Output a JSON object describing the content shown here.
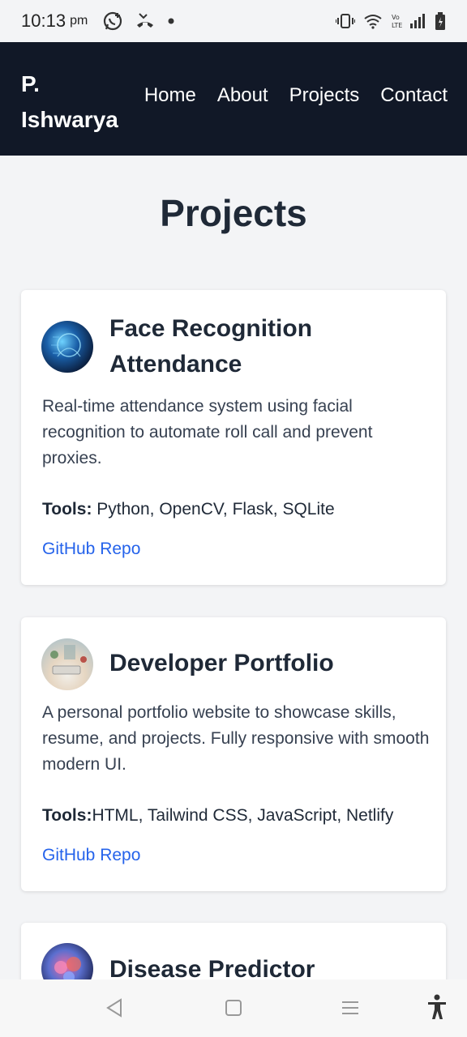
{
  "status": {
    "time": "10:13",
    "ampm": "pm"
  },
  "nav": {
    "brand_line1": "P.",
    "brand_line2": "Ishwarya",
    "links": [
      "Home",
      "About",
      "Projects",
      "Contact"
    ]
  },
  "page": {
    "title": "Projects"
  },
  "projects": [
    {
      "title": "Face Recognition Attendance",
      "description": "Real-time attendance system using facial recognition to automate roll call and prevent proxies.",
      "tools_label": "Tools:",
      "tools": " Python, OpenCV, Flask, SQLite",
      "link": "GitHub Repo"
    },
    {
      "title": "Developer Portfolio",
      "description": "A personal portfolio website to showcase skills, resume, and projects. Fully responsive with smooth modern UI.",
      "tools_label": "Tools:",
      "tools": "HTML, Tailwind CSS, JavaScript, Netlify",
      "link": "GitHub Repo"
    },
    {
      "title": "Disease Predictor"
    }
  ],
  "colors": {
    "nav_bg": "#111827",
    "link": "#2563eb",
    "page_bg": "#f3f4f6"
  }
}
